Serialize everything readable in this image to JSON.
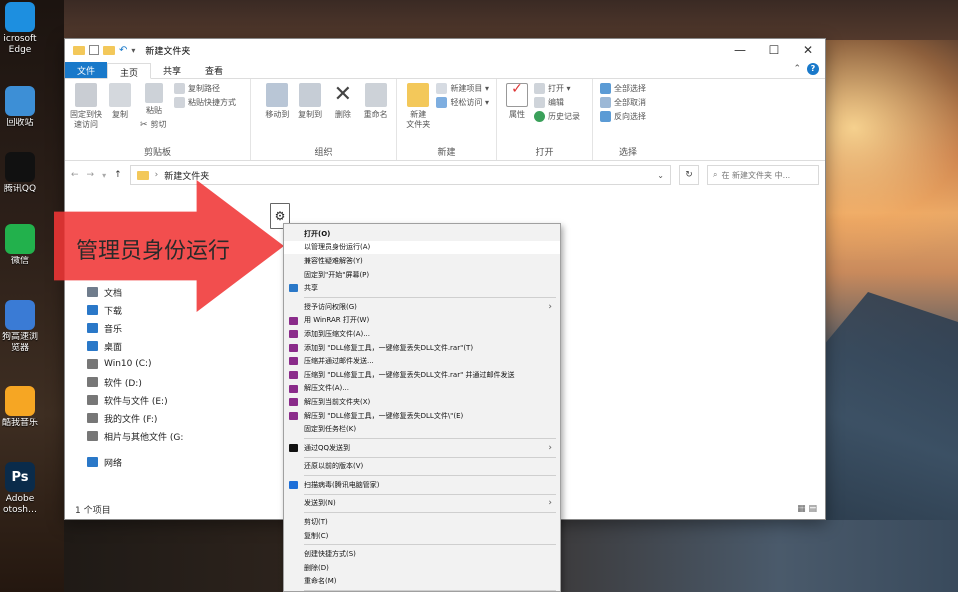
{
  "desktop_icons": [
    {
      "label": "icrosoft",
      "label2": "Edge",
      "color": "#1d8fe0",
      "icon": "edge-icon"
    },
    {
      "label": "回收站",
      "color": "#3d8fd6",
      "icon": "recycle-bin-icon"
    },
    {
      "label": "腾讯QQ",
      "color": "#111111",
      "icon": "qq-icon"
    },
    {
      "label": "微信",
      "color": "#22b14c",
      "icon": "wechat-icon"
    },
    {
      "label": "狗高速浏",
      "label2": "览器",
      "color": "#3a7bd5",
      "icon": "sogou-browser-icon"
    },
    {
      "label": "酷我音乐",
      "color": "#f6a623",
      "icon": "kuwo-music-icon"
    },
    {
      "label": "Adobe",
      "label2": "otosh…",
      "color": "#0a2b4a",
      "icon": "photoshop-icon",
      "glyph": "Ps"
    }
  ],
  "window": {
    "title": "新建文件夹",
    "buttons": {
      "min": "—",
      "max": "☐",
      "close": "✕"
    },
    "tabs": [
      "文件",
      "主页",
      "共享",
      "查看"
    ],
    "ribbon": {
      "clipboard": {
        "label": "剪贴板",
        "pin": "固定到快速访问",
        "copy": "复制",
        "paste": "粘贴",
        "copy_path": "复制路径",
        "paste_shortcut": "粘贴快捷方式",
        "cut": "剪切"
      },
      "organize": {
        "label": "组织",
        "move_to": "移动到",
        "copy_to": "复制到",
        "delete": "删除",
        "rename": "重命名"
      },
      "new": {
        "label": "新建",
        "new_folder": "新建\n文件夹",
        "new_item": "新建项目 ▾",
        "easy_access": "轻松访问 ▾"
      },
      "open": {
        "label": "打开",
        "properties": "属性",
        "open": "打开 ▾",
        "edit": "编辑",
        "history": "历史记录"
      },
      "select": {
        "label": "选择",
        "select_all": "全部选择",
        "select_none": "全部取消",
        "invert": "反向选择"
      }
    },
    "address": {
      "path": "新建文件夹",
      "search_placeholder": "在 新建文件夹 中..."
    },
    "nav": [
      {
        "label": "文档",
        "color": "#6f7c8c"
      },
      {
        "label": "下载",
        "color": "#2a78c8"
      },
      {
        "label": "音乐",
        "color": "#2a78c8"
      },
      {
        "label": "桌面",
        "color": "#2a78c8"
      },
      {
        "label": "Win10 (C:)",
        "color": "#777777"
      },
      {
        "label": "软件 (D:)",
        "color": "#777777"
      },
      {
        "label": "软件与文件 (E:)",
        "color": "#777777"
      },
      {
        "label": "我的文件 (F:)",
        "color": "#777777"
      },
      {
        "label": "相片与其他文件 (G:",
        "color": "#777777"
      },
      {
        "label": "网络",
        "color": "#2a78c8"
      }
    ],
    "status": "1 个项目"
  },
  "overlay_text": "管理员身份运行",
  "context_menu": [
    {
      "label": "打开(O)",
      "bold": true
    },
    {
      "label": "以管理员身份运行(A)",
      "hl": true
    },
    {
      "label": "兼容性疑难解答(Y)"
    },
    {
      "label": "固定到\"开始\"屏幕(P)"
    },
    {
      "label": "共享",
      "icon": "#2a78c8"
    },
    {
      "sep": true
    },
    {
      "label": "授予访问权限(G)",
      "sub": true
    },
    {
      "label": "用 WinRAR 打开(W)",
      "icon": "#8a2b8a"
    },
    {
      "label": "添加到压缩文件(A)...",
      "icon": "#8a2b8a"
    },
    {
      "label": "添加到 \"DLL修复工具，一键修复丢失DLL文件.rar\"(T)",
      "icon": "#8a2b8a"
    },
    {
      "label": "压缩并通过邮件发送...",
      "icon": "#8a2b8a"
    },
    {
      "label": "压缩到 \"DLL修复工具，一键修复丢失DLL文件.rar\" 并通过邮件发送",
      "icon": "#8a2b8a"
    },
    {
      "label": "解压文件(A)...",
      "icon": "#8a2b8a"
    },
    {
      "label": "解压到当前文件夹(X)",
      "icon": "#8a2b8a"
    },
    {
      "label": "解压到 \"DLL修复工具，一键修复丢失DLL文件\\\"(E)",
      "icon": "#8a2b8a"
    },
    {
      "label": "固定到任务栏(K)"
    },
    {
      "sep": true
    },
    {
      "label": "通过QQ发送到",
      "icon": "#111111",
      "sub": true
    },
    {
      "sep": true
    },
    {
      "label": "还原以前的版本(V)"
    },
    {
      "sep": true
    },
    {
      "label": "扫描病毒(腾讯电脑管家)",
      "icon": "#1d6fd8"
    },
    {
      "sep": true
    },
    {
      "label": "发送到(N)",
      "sub": true
    },
    {
      "sep": true
    },
    {
      "label": "剪切(T)"
    },
    {
      "label": "复制(C)"
    },
    {
      "sep": true
    },
    {
      "label": "创建快捷方式(S)"
    },
    {
      "label": "删除(D)"
    },
    {
      "label": "重命名(M)"
    },
    {
      "sep": true
    }
  ]
}
